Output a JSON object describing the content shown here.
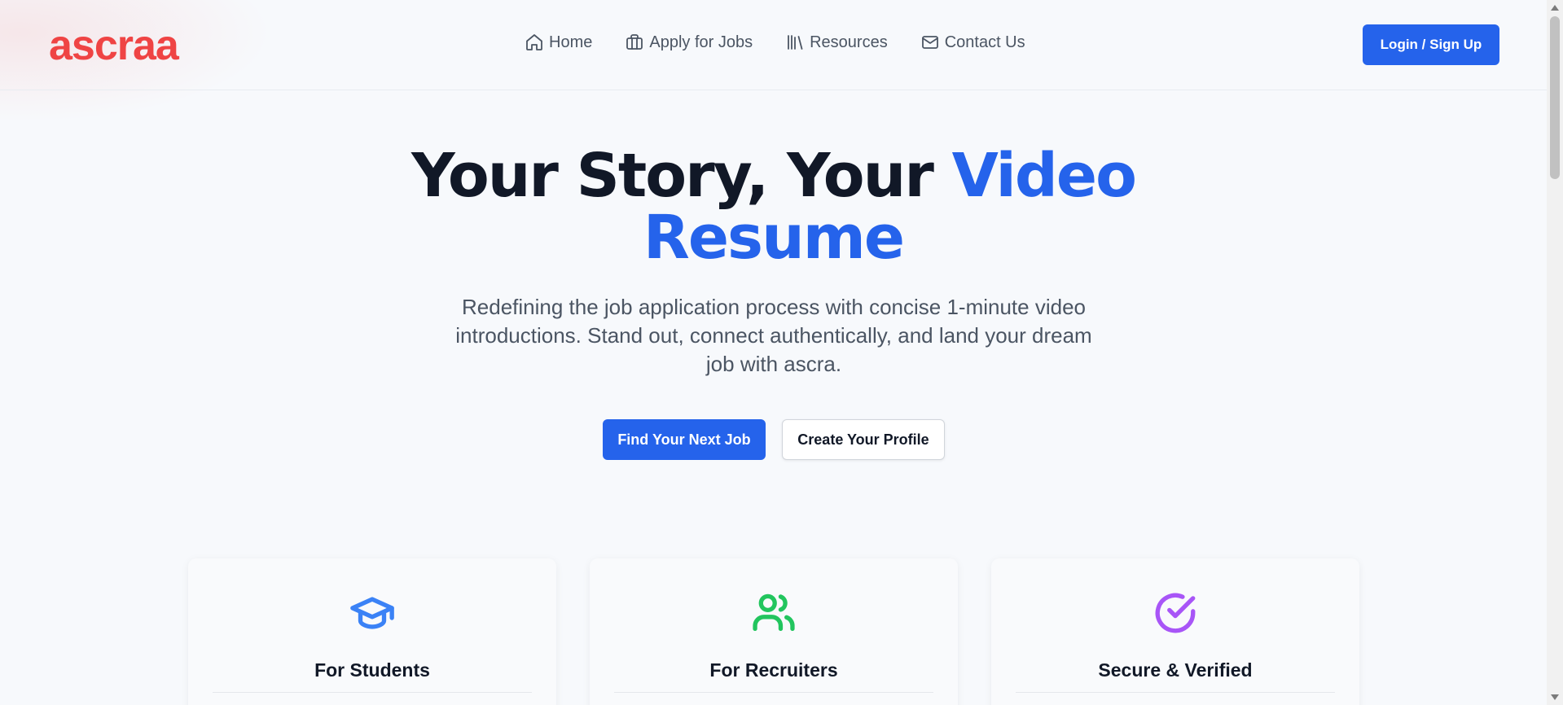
{
  "brand": {
    "logo": "ascraa",
    "logo_color": "#ef4444"
  },
  "nav": {
    "items": [
      {
        "label": "Home",
        "icon": "home-icon"
      },
      {
        "label": "Apply for Jobs",
        "icon": "briefcase-icon"
      },
      {
        "label": "Resources",
        "icon": "library-icon"
      },
      {
        "label": "Contact Us",
        "icon": "mail-icon"
      }
    ],
    "login_label": "Login / Sign Up"
  },
  "hero": {
    "title_part1": "Your Story, Your ",
    "title_accent_1": "Video",
    "title_accent_2": "Resume",
    "subtitle": "Redefining the job application process with concise 1-minute video introductions. Stand out, connect authentically, and land your dream job with ascra.",
    "primary_cta": "Find Your Next Job",
    "secondary_cta": "Create Your Profile"
  },
  "cards": [
    {
      "title": "For Students",
      "icon": "graduation-cap-icon",
      "color": "#3b82f6"
    },
    {
      "title": "For Recruiters",
      "icon": "users-icon",
      "color": "#22c55e"
    },
    {
      "title": "Secure & Verified",
      "icon": "check-circle-icon",
      "color": "#a855f7"
    }
  ],
  "colors": {
    "accent": "#2563eb",
    "text": "#111827",
    "muted": "#4b5563"
  }
}
